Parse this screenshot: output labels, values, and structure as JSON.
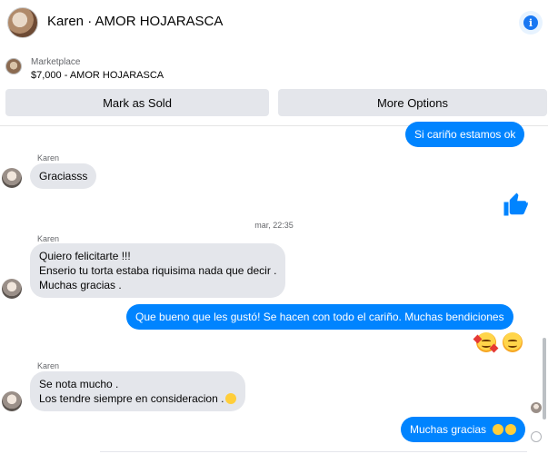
{
  "header": {
    "title": "Karen · AMOR HOJARASCA",
    "info_icon": "info-icon"
  },
  "marketplace": {
    "label": "Marketplace",
    "price_line": "$7,000 - AMOR HOJARASCA"
  },
  "actions": {
    "mark_sold": "Mark as Sold",
    "more_options": "More Options"
  },
  "messages": [
    {
      "from": "me",
      "text": "Si cariño estamos ok"
    },
    {
      "from": "Karen",
      "sender": "Karen",
      "text": "Graciasss"
    },
    {
      "from": "me",
      "type": "like",
      "icon": "thumbs-up-icon"
    },
    {
      "type": "timestamp",
      "text": "mar, 22:35"
    },
    {
      "from": "Karen",
      "sender": "Karen",
      "lines": [
        "Quiero felicitarte !!!",
        "Enserio tu torta estaba riquisima nada que decir .",
        "Muchas gracias ."
      ]
    },
    {
      "from": "me",
      "text": "Que bueno que les gustó! Se hacen con todo el cariño. Muchas bendiciones"
    },
    {
      "from": "me",
      "type": "emojis",
      "icons": [
        "smiling-face-with-hearts-icon",
        "smiling-face-icon"
      ]
    },
    {
      "from": "Karen",
      "sender": "Karen",
      "lines": [
        "Se nota mucho .",
        "Los tendre siempre en consideracion ."
      ]
    },
    {
      "from": "me",
      "text": "Muchas gracias"
    }
  ],
  "colors": {
    "accent": "#0084ff",
    "incoming_bubble": "#e4e6eb",
    "button_bg": "#e4e6eb",
    "info_blue": "#1877f2"
  }
}
